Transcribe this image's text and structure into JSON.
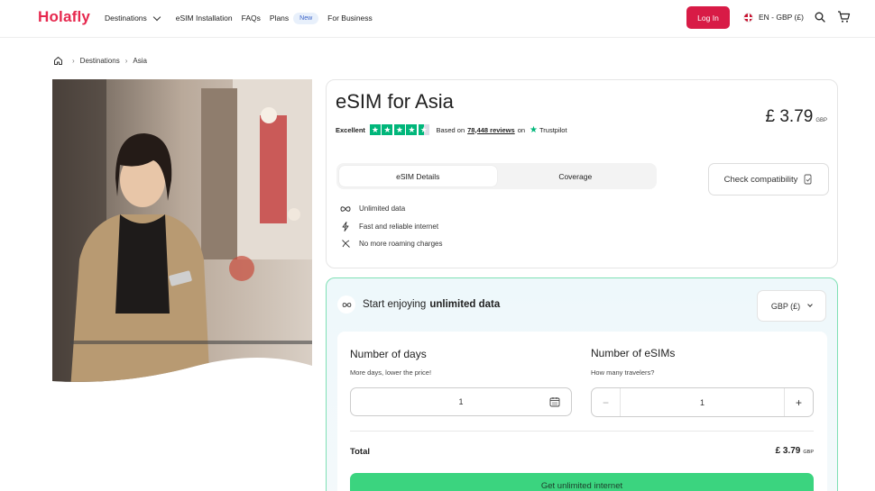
{
  "header": {
    "logo": "Holafly",
    "nav": {
      "destinations": "Destinations",
      "esim_installation": "eSIM Installation",
      "faqs": "FAQs",
      "plans": "Plans",
      "new_badge": "New",
      "for_business": "For Business"
    },
    "login": "Log In",
    "language": "EN - GBP (£)"
  },
  "breadcrumb": {
    "home_icon": "home-icon",
    "items": [
      "Destinations",
      "Asia"
    ]
  },
  "product": {
    "title": "eSIM for Asia",
    "price": "£ 3.79",
    "price_currency": "GBP",
    "rating": {
      "label": "Excellent",
      "stars": 4.5,
      "based_on": "Based on",
      "reviews": "78,448 reviews",
      "on": "on",
      "provider": "Trustpilot"
    },
    "tabs": [
      "eSIM Details",
      "Coverage"
    ],
    "active_tab": 0,
    "check_compatibility": "Check compatibility",
    "features": [
      {
        "icon": "infinity-icon",
        "label": "Unlimited data"
      },
      {
        "icon": "lightning-icon",
        "label": "Fast and reliable internet"
      },
      {
        "icon": "no-roaming-icon",
        "label": "No more roaming charges"
      }
    ]
  },
  "plan": {
    "headline_prefix": "Start enjoying",
    "headline_bold": "unlimited data",
    "currency_select": "GBP (£)",
    "days": {
      "title": "Number of days",
      "subtitle": "More days, lower the price!",
      "value": "1"
    },
    "esims": {
      "title": "Number of eSIMs",
      "subtitle": "How many travelers?",
      "value": "1",
      "minus": "−",
      "plus": "+"
    },
    "total_label": "Total",
    "total_value": "£ 3.79",
    "total_currency": "GBP",
    "cta": "Get unlimited internet"
  },
  "colors": {
    "brand": "#e6284e",
    "login_bg": "#d81b46",
    "trustpilot": "#00b67a",
    "cta": "#3bd47f",
    "plan_border": "#7fe0b5"
  }
}
